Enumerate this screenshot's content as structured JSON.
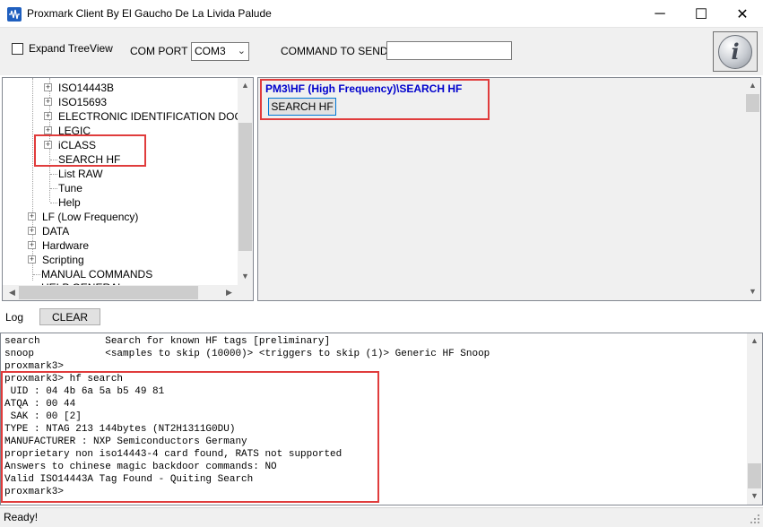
{
  "window": {
    "title": "Proxmark Client By El Gaucho De La Livida Palude",
    "minimize_glyph": "─",
    "maximize_glyph": "☐",
    "close_glyph": "✕"
  },
  "toolbar": {
    "expand_treeview_label": "Expand TreeView",
    "expand_treeview_checked": false,
    "com_port_label": "COM PORT",
    "com_port_value": "COM3",
    "command_label": "COMMAND TO SEND",
    "command_value": "",
    "info_icon": "info-icon",
    "info_glyph": "i"
  },
  "tree": {
    "items": [
      {
        "label": "ISO14443B",
        "expandable": true
      },
      {
        "label": "ISO15693",
        "expandable": true
      },
      {
        "label": "ELECTRONIC IDENTIFICATION DOCUM",
        "expandable": true
      },
      {
        "label": "LEGIC",
        "expandable": true
      },
      {
        "label": "iCLASS",
        "expandable": true
      },
      {
        "label": "SEARCH HF",
        "expandable": false
      },
      {
        "label": "List RAW",
        "expandable": false
      },
      {
        "label": "Tune",
        "expandable": false
      },
      {
        "label": "Help",
        "expandable": false
      },
      {
        "label": "LF (Low Frequency)",
        "expandable": true
      },
      {
        "label": "DATA",
        "expandable": true
      },
      {
        "label": "Hardware",
        "expandable": true
      },
      {
        "label": "Scripting",
        "expandable": true
      },
      {
        "label": "MANUAL COMMANDS",
        "expandable": false
      },
      {
        "label": "HELP GENERAL",
        "expandable": false
      }
    ]
  },
  "right_panel": {
    "path": "PM3\\HF (High Frequency)\\SEARCH HF",
    "button_label": "SEARCH HF"
  },
  "log": {
    "label": "Log",
    "clear_label": "CLEAR",
    "lines": [
      "search           Search for known HF tags [preliminary]",
      "snoop            <samples to skip (10000)> <triggers to skip (1)> Generic HF Snoop",
      "proxmark3>",
      "proxmark3> hf search",
      " UID : 04 4b 6a 5a b5 49 81",
      "ATQA : 00 44",
      " SAK : 00 [2]",
      "TYPE : NTAG 213 144bytes (NT2H1311G0DU)",
      "MANUFACTURER : NXP Semiconductors Germany",
      "proprietary non iso14443-4 card found, RATS not supported",
      "Answers to chinese magic backdoor commands: NO",
      "Valid ISO14443A Tag Found - Quiting Search",
      "proxmark3>"
    ]
  },
  "status": {
    "text": "Ready!"
  },
  "colors": {
    "highlight_box": "#e03c3c",
    "path_text": "#0000cc",
    "focus_border": "#0078d7"
  }
}
